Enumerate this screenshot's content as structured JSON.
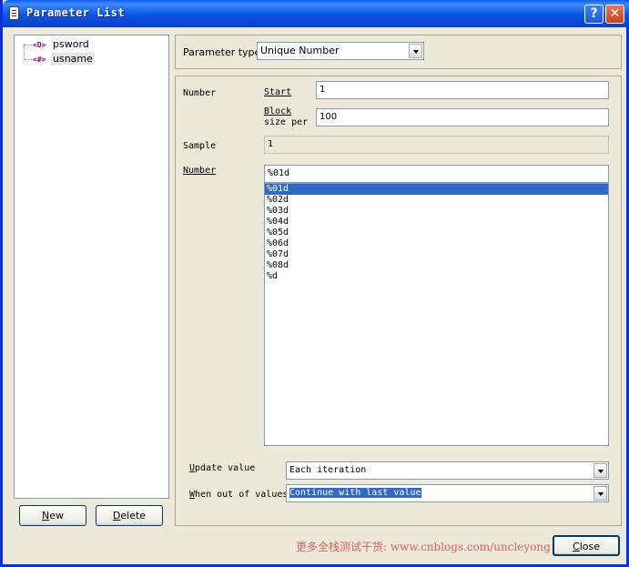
{
  "window": {
    "title": "Parameter List"
  },
  "tree": {
    "items": [
      {
        "icon": "<D>",
        "label": "psword"
      },
      {
        "icon": "<#>",
        "label": "usname"
      }
    ]
  },
  "buttons": {
    "new": "New",
    "delete": "Delete",
    "close": "Close"
  },
  "parameter_type": {
    "label": "Parameter type:",
    "value": "Unique Number"
  },
  "number_group": {
    "section_label": "Number",
    "start_label": "Start",
    "start_value": "1",
    "block_label_1": "Block",
    "block_label_2": "size per",
    "block_value": "100",
    "sample_label": "Sample",
    "sample_value": "1",
    "format_label": "Number",
    "format_value": "%01d",
    "format_options": [
      "%01d",
      "%02d",
      "%03d",
      "%04d",
      "%05d",
      "%06d",
      "%07d",
      "%08d",
      "%d"
    ],
    "selected_format": "%01d"
  },
  "update": {
    "label": "Update value",
    "value": "Each iteration"
  },
  "out_of_values": {
    "label": "When out of values",
    "value": "Continue with last value"
  },
  "watermark": "更多全栈测试干货: www.cnblogs.com/uncleyong"
}
